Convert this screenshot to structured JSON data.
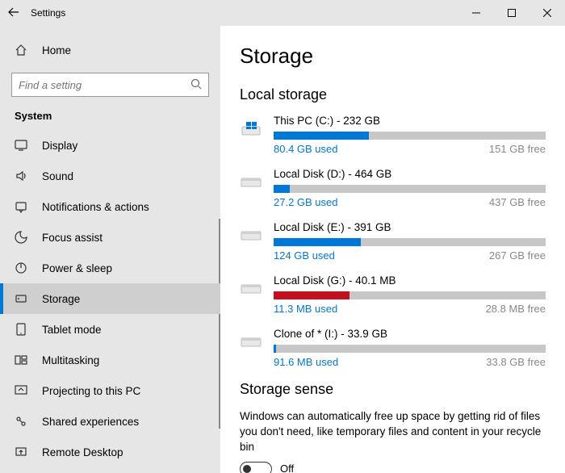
{
  "window": {
    "title": "Settings"
  },
  "home_label": "Home",
  "search": {
    "placeholder": "Find a setting"
  },
  "section_label": "System",
  "nav": [
    {
      "icon": "display",
      "label": "Display"
    },
    {
      "icon": "sound",
      "label": "Sound"
    },
    {
      "icon": "notifications",
      "label": "Notifications & actions"
    },
    {
      "icon": "focus",
      "label": "Focus assist"
    },
    {
      "icon": "power",
      "label": "Power & sleep"
    },
    {
      "icon": "storage",
      "label": "Storage"
    },
    {
      "icon": "tablet",
      "label": "Tablet mode"
    },
    {
      "icon": "multitask",
      "label": "Multitasking"
    },
    {
      "icon": "projecting",
      "label": "Projecting to this PC"
    },
    {
      "icon": "shared",
      "label": "Shared experiences"
    },
    {
      "icon": "remote",
      "label": "Remote Desktop"
    }
  ],
  "main": {
    "title": "Storage",
    "local_storage_label": "Local storage",
    "drives": [
      {
        "os": true,
        "name": "This PC (C:) - 232 GB",
        "used": "80.4 GB used",
        "free": "151 GB free",
        "pct": 35,
        "color": "#0078d7"
      },
      {
        "os": false,
        "name": "Local Disk (D:) - 464 GB",
        "used": "27.2 GB used",
        "free": "437 GB free",
        "pct": 6,
        "color": "#0078d7"
      },
      {
        "os": false,
        "name": "Local Disk (E:) - 391 GB",
        "used": "124 GB used",
        "free": "267 GB free",
        "pct": 32,
        "color": "#0078d7"
      },
      {
        "os": false,
        "name": "Local Disk (G:) - 40.1 MB",
        "used": "11.3 MB used",
        "free": "28.8 MB free",
        "pct": 28,
        "color": "#c50f1f"
      },
      {
        "os": false,
        "name": "Clone of * (I:) - 33.9 GB",
        "used": "91.6 MB used",
        "free": "33.8 GB free",
        "pct": 1,
        "color": "#0078d7"
      }
    ],
    "sense_title": "Storage sense",
    "sense_text": "Windows can automatically free up space by getting rid of files you don't need, like temporary files and content in your recycle bin",
    "sense_toggle": "Off"
  }
}
